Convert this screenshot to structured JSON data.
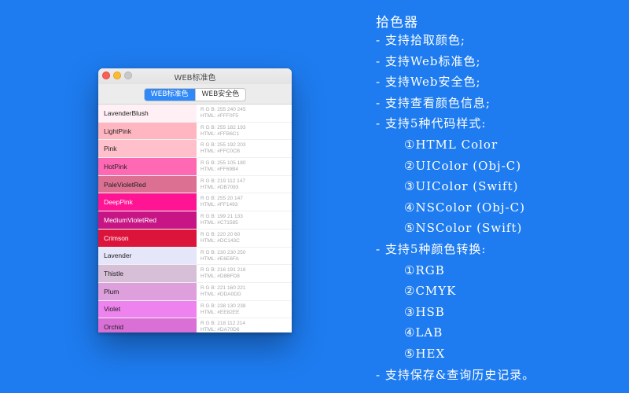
{
  "window": {
    "title": "WEB标准色",
    "tabs": [
      {
        "label": "WEB标准色",
        "active": true
      },
      {
        "label": "WEB安全色",
        "active": false
      }
    ]
  },
  "colors": [
    {
      "name": "LavenderBlush",
      "hex": "#FFF0F5",
      "rgb": "R G B: 255 240 245",
      "html": "HTML: #FFF0F5",
      "light_text": false
    },
    {
      "name": "LightPink",
      "hex": "#FFB6C1",
      "rgb": "R G B: 255 182 193",
      "html": "HTML: #FFB6C1",
      "light_text": false
    },
    {
      "name": "Pink",
      "hex": "#FFC0CB",
      "rgb": "R G B: 255 192 203",
      "html": "HTML: #FFC0CB",
      "light_text": false
    },
    {
      "name": "HotPink",
      "hex": "#FF69B4",
      "rgb": "R G B: 255 105 180",
      "html": "HTML: #FF69B4",
      "light_text": false
    },
    {
      "name": "PaleVioletRed",
      "hex": "#DB7093",
      "rgb": "R G B: 219 112 147",
      "html": "HTML: #DB7093",
      "light_text": false
    },
    {
      "name": "DeepPink",
      "hex": "#FF1493",
      "rgb": "R G B: 255 20 147",
      "html": "HTML: #FF1493",
      "light_text": true
    },
    {
      "name": "MediumVioletRed",
      "hex": "#C71585",
      "rgb": "R G B: 199 21 133",
      "html": "HTML: #C71585",
      "light_text": true
    },
    {
      "name": "Crimson",
      "hex": "#DC143C",
      "rgb": "R G B: 220 20 60",
      "html": "HTML: #DC143C",
      "light_text": true
    },
    {
      "name": "Lavender",
      "hex": "#E6E6FA",
      "rgb": "R G B: 230 230 250",
      "html": "HTML: #E6E6FA",
      "light_text": false
    },
    {
      "name": "Thistle",
      "hex": "#D8BFD8",
      "rgb": "R G B: 216 191 216",
      "html": "HTML: #D8BFD8",
      "light_text": false
    },
    {
      "name": "Plum",
      "hex": "#DDA0DD",
      "rgb": "R G B: 221 160 221",
      "html": "HTML: #DDA0DD",
      "light_text": false
    },
    {
      "name": "Violet",
      "hex": "#EE82EE",
      "rgb": "R G B: 238 130 238",
      "html": "HTML: #EE82EE",
      "light_text": false
    },
    {
      "name": "Orchid",
      "hex": "#DA70D6",
      "rgb": "R G B: 218 112 214",
      "html": "HTML: #DA70D6",
      "light_text": false
    }
  ],
  "features": {
    "title": "拾色器",
    "lines": [
      {
        "text": "- 支持拾取颜色;",
        "sub": false
      },
      {
        "text": "- 支持Web标准色;",
        "sub": false
      },
      {
        "text": "- 支持Web安全色;",
        "sub": false
      },
      {
        "text": "- 支持查看颜色信息;",
        "sub": false
      },
      {
        "text": "- 支持5种代码样式:",
        "sub": false
      },
      {
        "text": "①HTML Color",
        "sub": true
      },
      {
        "text": "②UIColor (Obj-C)",
        "sub": true
      },
      {
        "text": "③UIColor (Swift)",
        "sub": true
      },
      {
        "text": "④NSColor (Obj-C)",
        "sub": true
      },
      {
        "text": "⑤NSColor (Swift)",
        "sub": true
      },
      {
        "text": "- 支持5种颜色转换:",
        "sub": false
      },
      {
        "text": "①RGB",
        "sub": true
      },
      {
        "text": "②CMYK",
        "sub": true
      },
      {
        "text": "③HSB",
        "sub": true
      },
      {
        "text": "④LAB",
        "sub": true
      },
      {
        "text": "⑤HEX",
        "sub": true
      },
      {
        "text": "- 支持保存&查询历史记录。",
        "sub": false
      }
    ]
  },
  "theme": {
    "background": "#1E7CF0",
    "accent": "#2F89F8"
  }
}
